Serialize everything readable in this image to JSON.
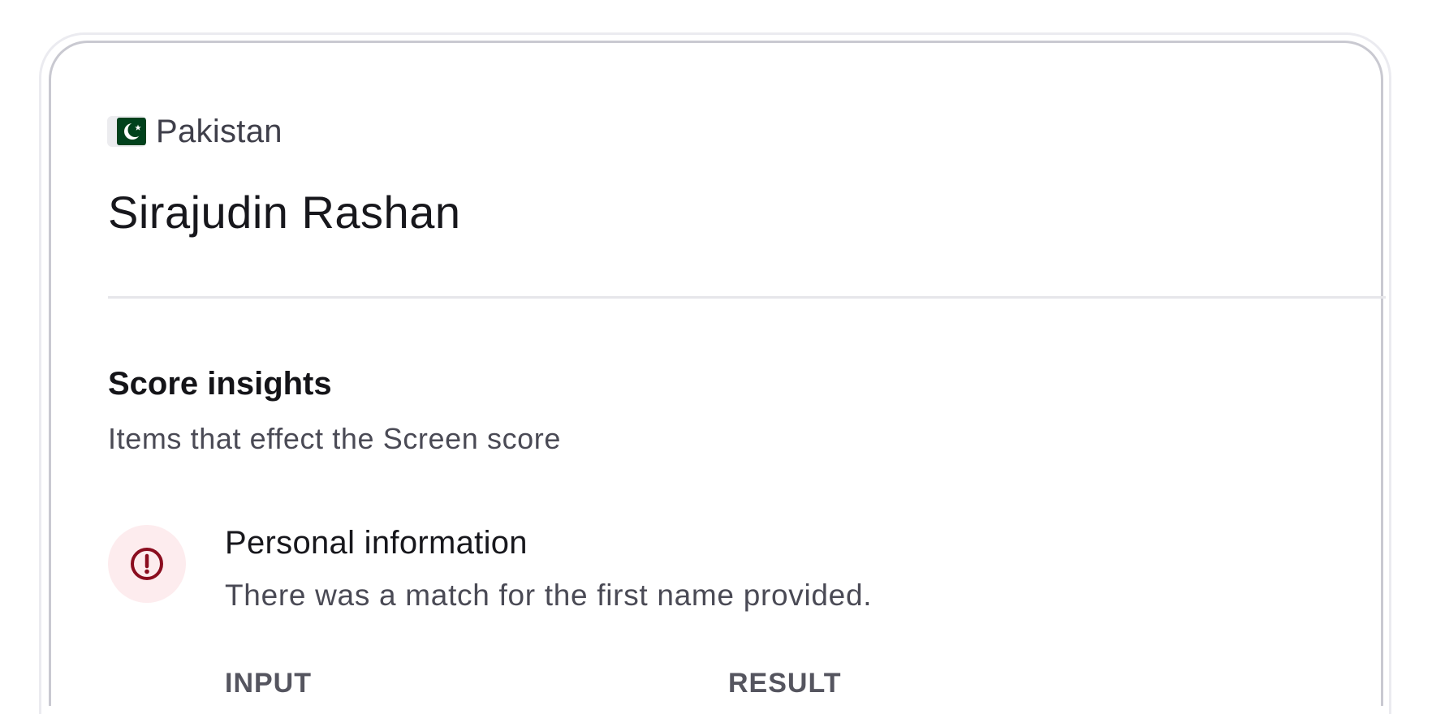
{
  "profile": {
    "country": "Pakistan",
    "country_flag_icon": "pakistan-flag-icon",
    "name": "Sirajudin Rashan"
  },
  "score_insights": {
    "title": "Score insights",
    "subtitle": "Items that effect the Screen score",
    "items": [
      {
        "icon": "alert-circle-icon",
        "title": "Personal information",
        "description": "There was a match for the first name provided.",
        "columns": [
          "INPUT",
          "RESULT"
        ]
      }
    ]
  },
  "colors": {
    "flag_green": "#01411c",
    "alert_red": "#8b0d1f",
    "alert_bg": "#fdecee",
    "card_border": "#c9c9d1"
  }
}
